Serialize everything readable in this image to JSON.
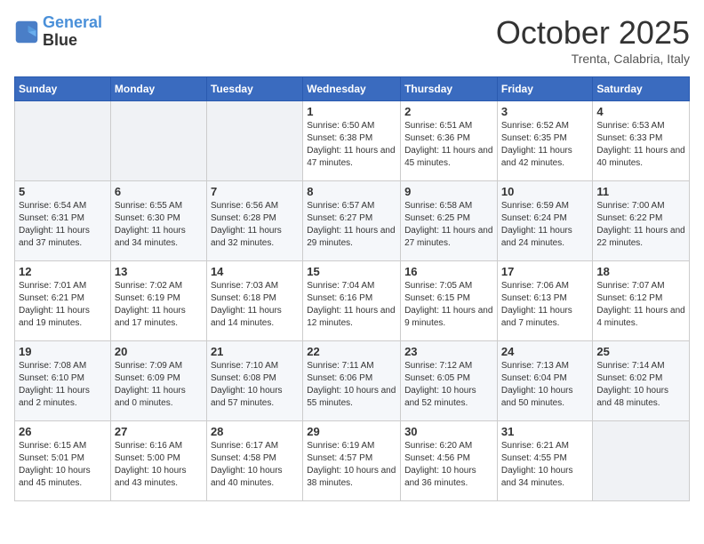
{
  "logo": {
    "line1": "General",
    "line2": "Blue"
  },
  "title": "October 2025",
  "subtitle": "Trenta, Calabria, Italy",
  "days_of_week": [
    "Sunday",
    "Monday",
    "Tuesday",
    "Wednesday",
    "Thursday",
    "Friday",
    "Saturday"
  ],
  "weeks": [
    [
      {
        "day": "",
        "info": ""
      },
      {
        "day": "",
        "info": ""
      },
      {
        "day": "",
        "info": ""
      },
      {
        "day": "1",
        "info": "Sunrise: 6:50 AM\nSunset: 6:38 PM\nDaylight: 11 hours and 47 minutes."
      },
      {
        "day": "2",
        "info": "Sunrise: 6:51 AM\nSunset: 6:36 PM\nDaylight: 11 hours and 45 minutes."
      },
      {
        "day": "3",
        "info": "Sunrise: 6:52 AM\nSunset: 6:35 PM\nDaylight: 11 hours and 42 minutes."
      },
      {
        "day": "4",
        "info": "Sunrise: 6:53 AM\nSunset: 6:33 PM\nDaylight: 11 hours and 40 minutes."
      }
    ],
    [
      {
        "day": "5",
        "info": "Sunrise: 6:54 AM\nSunset: 6:31 PM\nDaylight: 11 hours and 37 minutes."
      },
      {
        "day": "6",
        "info": "Sunrise: 6:55 AM\nSunset: 6:30 PM\nDaylight: 11 hours and 34 minutes."
      },
      {
        "day": "7",
        "info": "Sunrise: 6:56 AM\nSunset: 6:28 PM\nDaylight: 11 hours and 32 minutes."
      },
      {
        "day": "8",
        "info": "Sunrise: 6:57 AM\nSunset: 6:27 PM\nDaylight: 11 hours and 29 minutes."
      },
      {
        "day": "9",
        "info": "Sunrise: 6:58 AM\nSunset: 6:25 PM\nDaylight: 11 hours and 27 minutes."
      },
      {
        "day": "10",
        "info": "Sunrise: 6:59 AM\nSunset: 6:24 PM\nDaylight: 11 hours and 24 minutes."
      },
      {
        "day": "11",
        "info": "Sunrise: 7:00 AM\nSunset: 6:22 PM\nDaylight: 11 hours and 22 minutes."
      }
    ],
    [
      {
        "day": "12",
        "info": "Sunrise: 7:01 AM\nSunset: 6:21 PM\nDaylight: 11 hours and 19 minutes."
      },
      {
        "day": "13",
        "info": "Sunrise: 7:02 AM\nSunset: 6:19 PM\nDaylight: 11 hours and 17 minutes."
      },
      {
        "day": "14",
        "info": "Sunrise: 7:03 AM\nSunset: 6:18 PM\nDaylight: 11 hours and 14 minutes."
      },
      {
        "day": "15",
        "info": "Sunrise: 7:04 AM\nSunset: 6:16 PM\nDaylight: 11 hours and 12 minutes."
      },
      {
        "day": "16",
        "info": "Sunrise: 7:05 AM\nSunset: 6:15 PM\nDaylight: 11 hours and 9 minutes."
      },
      {
        "day": "17",
        "info": "Sunrise: 7:06 AM\nSunset: 6:13 PM\nDaylight: 11 hours and 7 minutes."
      },
      {
        "day": "18",
        "info": "Sunrise: 7:07 AM\nSunset: 6:12 PM\nDaylight: 11 hours and 4 minutes."
      }
    ],
    [
      {
        "day": "19",
        "info": "Sunrise: 7:08 AM\nSunset: 6:10 PM\nDaylight: 11 hours and 2 minutes."
      },
      {
        "day": "20",
        "info": "Sunrise: 7:09 AM\nSunset: 6:09 PM\nDaylight: 11 hours and 0 minutes."
      },
      {
        "day": "21",
        "info": "Sunrise: 7:10 AM\nSunset: 6:08 PM\nDaylight: 10 hours and 57 minutes."
      },
      {
        "day": "22",
        "info": "Sunrise: 7:11 AM\nSunset: 6:06 PM\nDaylight: 10 hours and 55 minutes."
      },
      {
        "day": "23",
        "info": "Sunrise: 7:12 AM\nSunset: 6:05 PM\nDaylight: 10 hours and 52 minutes."
      },
      {
        "day": "24",
        "info": "Sunrise: 7:13 AM\nSunset: 6:04 PM\nDaylight: 10 hours and 50 minutes."
      },
      {
        "day": "25",
        "info": "Sunrise: 7:14 AM\nSunset: 6:02 PM\nDaylight: 10 hours and 48 minutes."
      }
    ],
    [
      {
        "day": "26",
        "info": "Sunrise: 6:15 AM\nSunset: 5:01 PM\nDaylight: 10 hours and 45 minutes."
      },
      {
        "day": "27",
        "info": "Sunrise: 6:16 AM\nSunset: 5:00 PM\nDaylight: 10 hours and 43 minutes."
      },
      {
        "day": "28",
        "info": "Sunrise: 6:17 AM\nSunset: 4:58 PM\nDaylight: 10 hours and 40 minutes."
      },
      {
        "day": "29",
        "info": "Sunrise: 6:19 AM\nSunset: 4:57 PM\nDaylight: 10 hours and 38 minutes."
      },
      {
        "day": "30",
        "info": "Sunrise: 6:20 AM\nSunset: 4:56 PM\nDaylight: 10 hours and 36 minutes."
      },
      {
        "day": "31",
        "info": "Sunrise: 6:21 AM\nSunset: 4:55 PM\nDaylight: 10 hours and 34 minutes."
      },
      {
        "day": "",
        "info": ""
      }
    ]
  ]
}
